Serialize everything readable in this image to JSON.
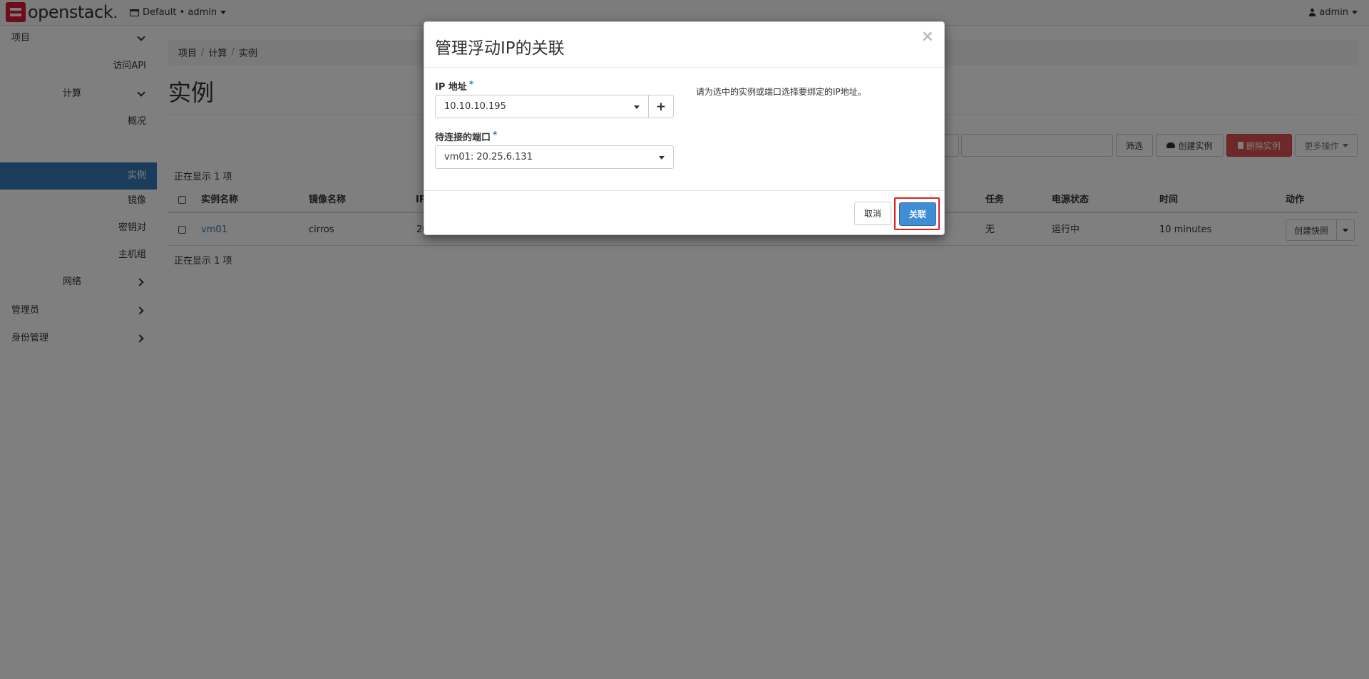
{
  "navbar": {
    "brand": "openstack",
    "brand_dot": ".",
    "project": "Default • admin",
    "user": "admin"
  },
  "sidebar": {
    "project": "项目",
    "api_access": "访问API",
    "compute": "计算",
    "overview": "概况",
    "instances": "实例",
    "images": "镜像",
    "keypairs": "密钥对",
    "server_groups": "主机组",
    "network": "网络",
    "admin": "管理员",
    "identity": "身份管理"
  },
  "breadcrumb": [
    "项目",
    "计算",
    "实例"
  ],
  "breadcrumb_sep": "/",
  "page": {
    "title": "实例",
    "count_top": "正在显示 1 项",
    "count_bottom": "正在显示 1 项"
  },
  "toolbar": {
    "filter": "筛选",
    "create": "创建实例",
    "delete": "删除实例",
    "more": "更多操作"
  },
  "table": {
    "headers": {
      "name": "实例名称",
      "image": "镜像名称",
      "ip": "IP",
      "task": "任务",
      "power": "电源状态",
      "time": "时间",
      "actions": "动作"
    },
    "rows": [
      {
        "name": "vm01",
        "image": "cirros",
        "ip_partial": "20",
        "task": "无",
        "power": "运行中",
        "time": "10 minutes",
        "action": "创建快照"
      }
    ]
  },
  "modal": {
    "title": "管理浮动IP的关联",
    "close": "×",
    "ip_label": "IP 地址",
    "ip_value": "10.10.10.195",
    "plus": "+",
    "port_label": "待连接的端口",
    "port_value": "vm01: 20.25.6.131",
    "required_mark": "*",
    "help": "请为选中的实例或端口选择要绑定的IP地址。",
    "cancel": "取消",
    "submit": "关联"
  },
  "colors": {
    "primary": "#337ab7",
    "danger": "#d9534f",
    "highlight": "#e51c23",
    "brand": "#da1a32"
  }
}
